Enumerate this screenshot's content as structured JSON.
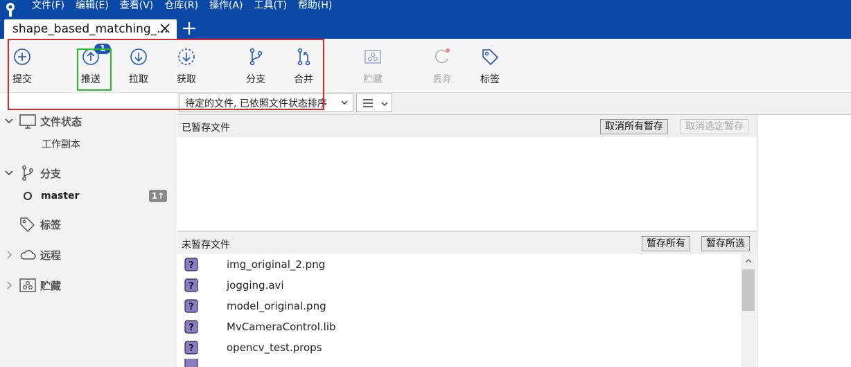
{
  "menu": [
    "文件(F)",
    "编辑(E)",
    "查看(V)",
    "仓库(R)",
    "操作(A)",
    "工具(T)",
    "帮助(H)"
  ],
  "tab": {
    "title": "shape_based_matching_..."
  },
  "toolbar": {
    "commit": "提交",
    "push": "推送",
    "push_badge": "1",
    "pull": "拉取",
    "fetch": "获取",
    "branch": "分支",
    "merge": "合并",
    "stash": "贮藏",
    "discard": "丢弃",
    "tag": "标签"
  },
  "subbar": {
    "sort_label": "待定的文件, 已依照文件状态排序"
  },
  "sidebar": {
    "file_status": "文件状态",
    "working_copy": "工作副本",
    "branches": "分支",
    "branch_master": "master",
    "branch_master_count": "1",
    "tags": "标签",
    "remotes": "远程",
    "stashes": "贮藏"
  },
  "staged": {
    "title": "已暂存文件",
    "unstage_all": "取消所有暂存",
    "unstage_selected": "取消选定暂存"
  },
  "unstaged": {
    "title": "未暂存文件",
    "stage_all": "暂存所有",
    "stage_selected": "暂存所选",
    "files": [
      "img_original_2.png",
      "jogging.avi",
      "model_original.png",
      "MvCameraControl.lib",
      "opencv_test.props"
    ]
  },
  "colors": {
    "accent": "#0a49a6",
    "icon_blue": "#1d57b3",
    "highlight_red": "#e0262c",
    "highlight_green": "#2dba2a",
    "unknown_file": "#8e7cc3"
  }
}
